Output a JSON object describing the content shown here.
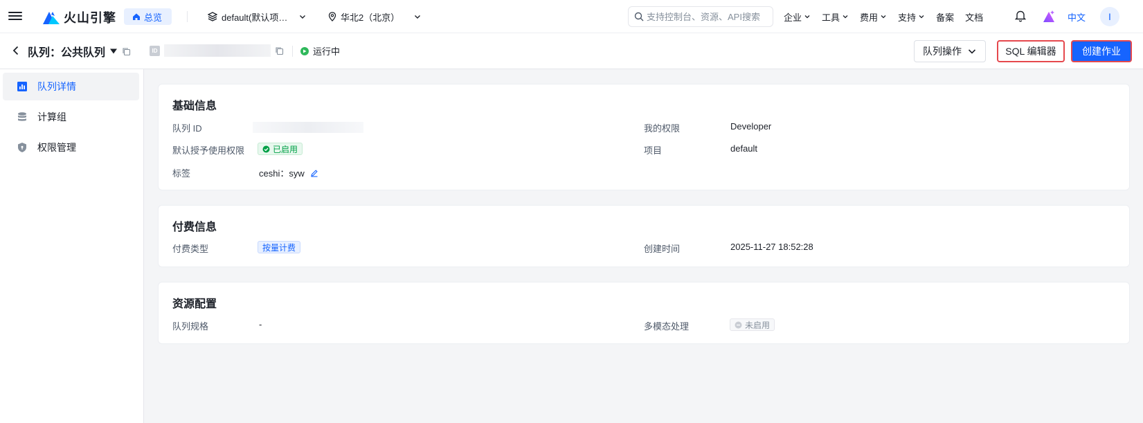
{
  "nav": {
    "brand": "火山引擎",
    "overview": "总览",
    "project": "default(默认项…",
    "region": "华北2（北京）",
    "search_placeholder": "支持控制台、资源、API搜索",
    "links": [
      "企业",
      "工具",
      "费用",
      "支持",
      "备案",
      "文档"
    ],
    "lang": "中文",
    "avatar_initial": "I"
  },
  "header": {
    "title": "队列：公共队列",
    "id_tag": "ID",
    "status": "运行中",
    "ops_button": "队列操作",
    "sql_button": "SQL 编辑器",
    "create_button": "创建作业"
  },
  "sidebar": {
    "items": [
      {
        "label": "队列详情",
        "icon": "chart-bar-icon",
        "active": true
      },
      {
        "label": "计算组",
        "icon": "database-icon",
        "active": false
      },
      {
        "label": "权限管理",
        "icon": "shield-icon",
        "active": false
      }
    ]
  },
  "basic": {
    "title": "基础信息",
    "queue_id_label": "队列 ID",
    "default_perm_label": "默认授予使用权限",
    "default_perm_value": "已启用",
    "tags_label": "标签",
    "tags_value": "ceshi：syw",
    "my_perm_label": "我的权限",
    "my_perm_value": "Developer",
    "project_label": "项目",
    "project_value": "default"
  },
  "billing": {
    "title": "付费信息",
    "type_label": "付费类型",
    "type_value": "按量计费",
    "created_label": "创建时间",
    "created_value": "2025-11-27 18:52:28"
  },
  "resource": {
    "title": "资源配置",
    "spec_label": "队列规格",
    "spec_value": "-",
    "multimodal_label": "多模态处理",
    "multimodal_value": "未启用"
  },
  "colors": {
    "primary": "#1664ff",
    "success": "#2fb85b",
    "highlight_border": "#e5484d"
  }
}
